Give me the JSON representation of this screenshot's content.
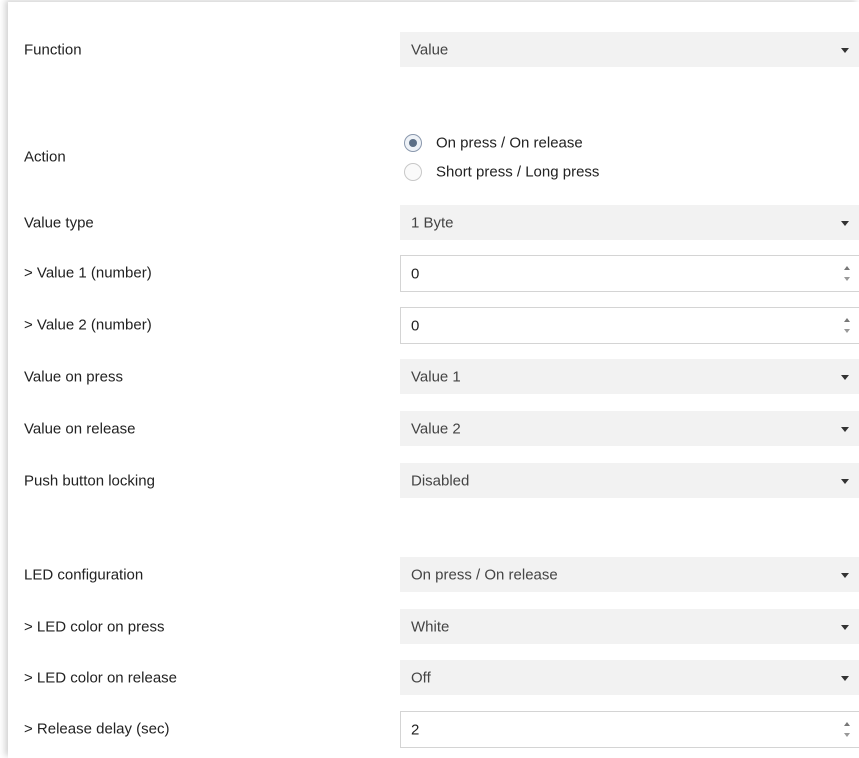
{
  "function": {
    "label": "Function",
    "value": "Value"
  },
  "action": {
    "label": "Action",
    "options": [
      {
        "label": "On press / On release",
        "selected": true
      },
      {
        "label": "Short press / Long press",
        "selected": false
      }
    ]
  },
  "value_type": {
    "label": "Value type",
    "value": "1 Byte"
  },
  "value1": {
    "label": "> Value 1 (number)",
    "value": "0"
  },
  "value2": {
    "label": "> Value 2 (number)",
    "value": "0"
  },
  "value_on_press": {
    "label": "Value on press",
    "value": "Value 1"
  },
  "value_on_release": {
    "label": "Value on release",
    "value": "Value 2"
  },
  "push_button_locking": {
    "label": "Push button locking",
    "value": "Disabled"
  },
  "led_configuration": {
    "label": "LED configuration",
    "value": "On press / On release"
  },
  "led_color_press": {
    "label": "> LED color on press",
    "value": "White"
  },
  "led_color_release": {
    "label": "> LED color on release",
    "value": "Off"
  },
  "release_delay": {
    "label": "> Release delay (sec)",
    "value": "2"
  },
  "colors": {
    "accent_radio": "#5c6f86",
    "combo_bg": "#f2f2f2"
  },
  "icons": {
    "dropdown": "chevron-down-icon",
    "spinner": "spinner-arrows-icon"
  }
}
